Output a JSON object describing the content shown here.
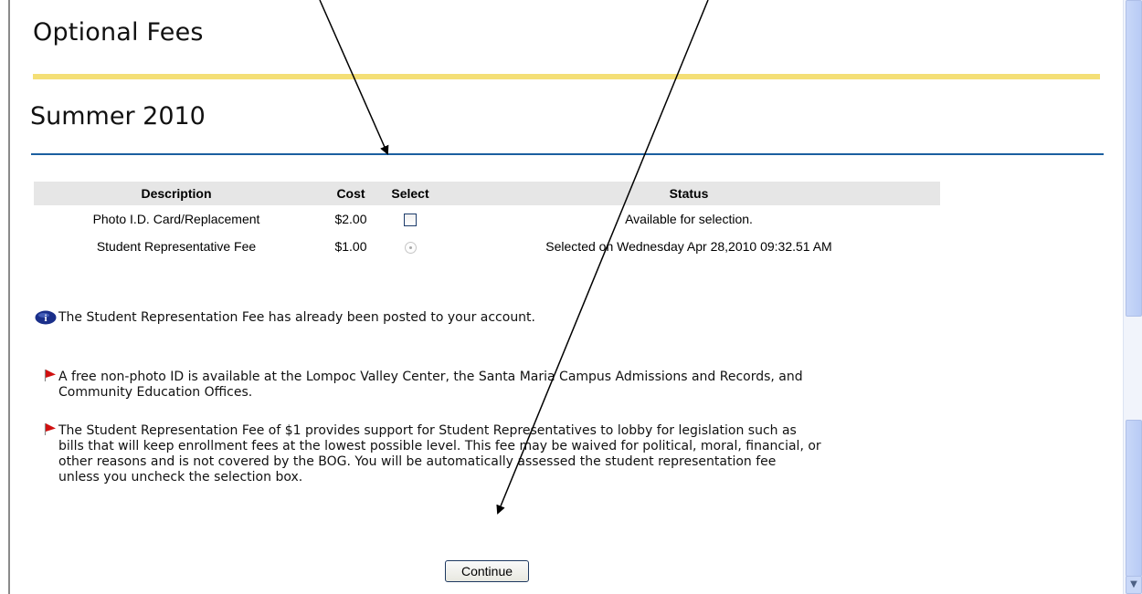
{
  "page": {
    "title": "Optional Fees",
    "term": "Summer 2010"
  },
  "table": {
    "headers": [
      "Description",
      "Cost",
      "Select",
      "Status"
    ],
    "rows": [
      {
        "description": "Photo I.D. Card/Replacement",
        "cost": "$2.00",
        "select_type": "checkbox",
        "checked": false,
        "status": "Available for selection."
      },
      {
        "description": "Student Representative Fee",
        "cost": "$1.00",
        "select_type": "radio",
        "checked": true,
        "status": "Selected on Wednesday Apr 28,2010 09:32.51 AM"
      }
    ]
  },
  "messages": {
    "info": "The Student Representation Fee has already been posted to your account.",
    "note1_line1": "A free non-photo ID is available at the Lompoc Valley Center, the Santa Maria Campus Admissions and Records, and",
    "note1_line2": "Community Education Offices.",
    "note2_line1": "The Student Representation Fee of $1 provides support for Student Representatives to lobby for legislation such as",
    "note2_line2": "bills that will keep enrollment fees at the lowest possible level. This fee may be waived for political, moral, financial, or",
    "note2_line3": "other reasons and is not covered by the BOG. You will be automatically assessed the student representation fee",
    "note2_line4": "unless you uncheck the selection box."
  },
  "buttons": {
    "continue_label": "Continue"
  },
  "icons": {
    "info": "info-icon",
    "flag": "red-flag-icon",
    "scroll_down": "chevron-down-icon"
  },
  "colors": {
    "yellow_rule": "#f4df76",
    "blue_rule": "#1b5fa0",
    "table_header_bg": "#e6e6e6",
    "flag_red": "#d01010",
    "info_blue": "#1a2f8a"
  }
}
